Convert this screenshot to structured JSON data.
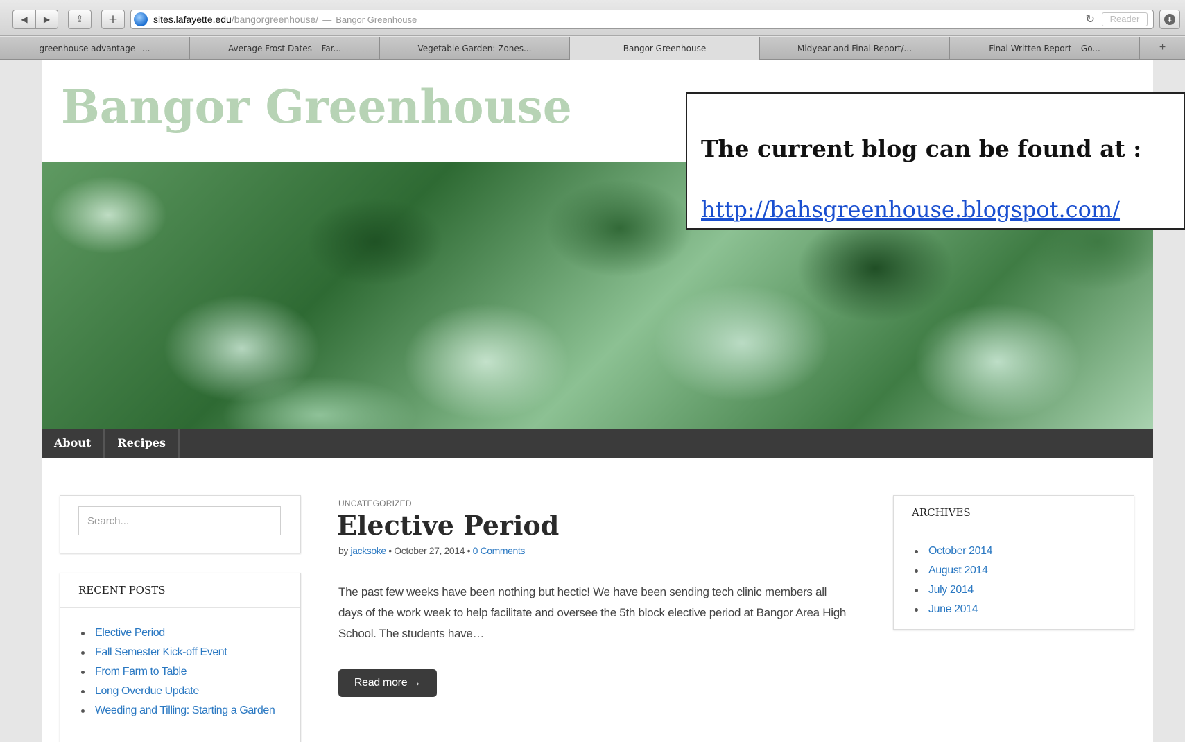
{
  "browser": {
    "url_domain": "sites.lafayette.edu",
    "url_path": "/bangorgreenhouse/",
    "url_separator": "—",
    "page_title": "Bangor Greenhouse",
    "reader_label": "Reader",
    "reload_icon": "↻",
    "back_icon": "◀",
    "forward_icon": "▶",
    "share_icon": "⇪",
    "add_icon": "+",
    "download_icon": "⬇",
    "new_tab_icon": "+",
    "tabs": [
      {
        "label": "greenhouse advantage –..."
      },
      {
        "label": "Average Frost Dates – Far..."
      },
      {
        "label": "Vegetable Garden: Zones..."
      },
      {
        "label": "Bangor Greenhouse"
      },
      {
        "label": "Midyear and Final Report/..."
      },
      {
        "label": "Final Written Report – Go..."
      }
    ]
  },
  "site": {
    "title": "Bangor Greenhouse",
    "menu": [
      {
        "label": "About"
      },
      {
        "label": "Recipes"
      }
    ]
  },
  "search": {
    "placeholder": "Search..."
  },
  "recent_posts": {
    "title": "RECENT POSTS",
    "items": [
      {
        "label": "Elective Period"
      },
      {
        "label": "Fall Semester Kick-off Event"
      },
      {
        "label": "From Farm to Table"
      },
      {
        "label": "Long Overdue Update"
      },
      {
        "label": "Weeding and Tilling: Starting a Garden"
      }
    ]
  },
  "post": {
    "category": "UNCATEGORIZED",
    "title": "Elective Period",
    "by": "by",
    "author": "jacksoke",
    "date": "October 27, 2014",
    "bullet": "•",
    "comments": "0 Comments",
    "excerpt": "The past few weeks have been nothing but hectic! We have been sending tech clinic members all days of the work week to help facilitate and oversee the 5th block elective period at Bangor Area High School. The students have…",
    "read_more": "Read more →"
  },
  "archives": {
    "title": "ARCHIVES",
    "items": [
      {
        "label": "October 2014"
      },
      {
        "label": "August 2014"
      },
      {
        "label": "July 2014"
      },
      {
        "label": "June 2014"
      }
    ]
  },
  "note": {
    "text": "The current blog can be found at :",
    "link": "http://bahsgreenhouse.blogspot.com/"
  },
  "colors": {
    "site_title": "#b7d3b5",
    "menu_bar": "#3b3b3b",
    "link": "#2a78c2",
    "note_link": "#1a4fd0"
  }
}
